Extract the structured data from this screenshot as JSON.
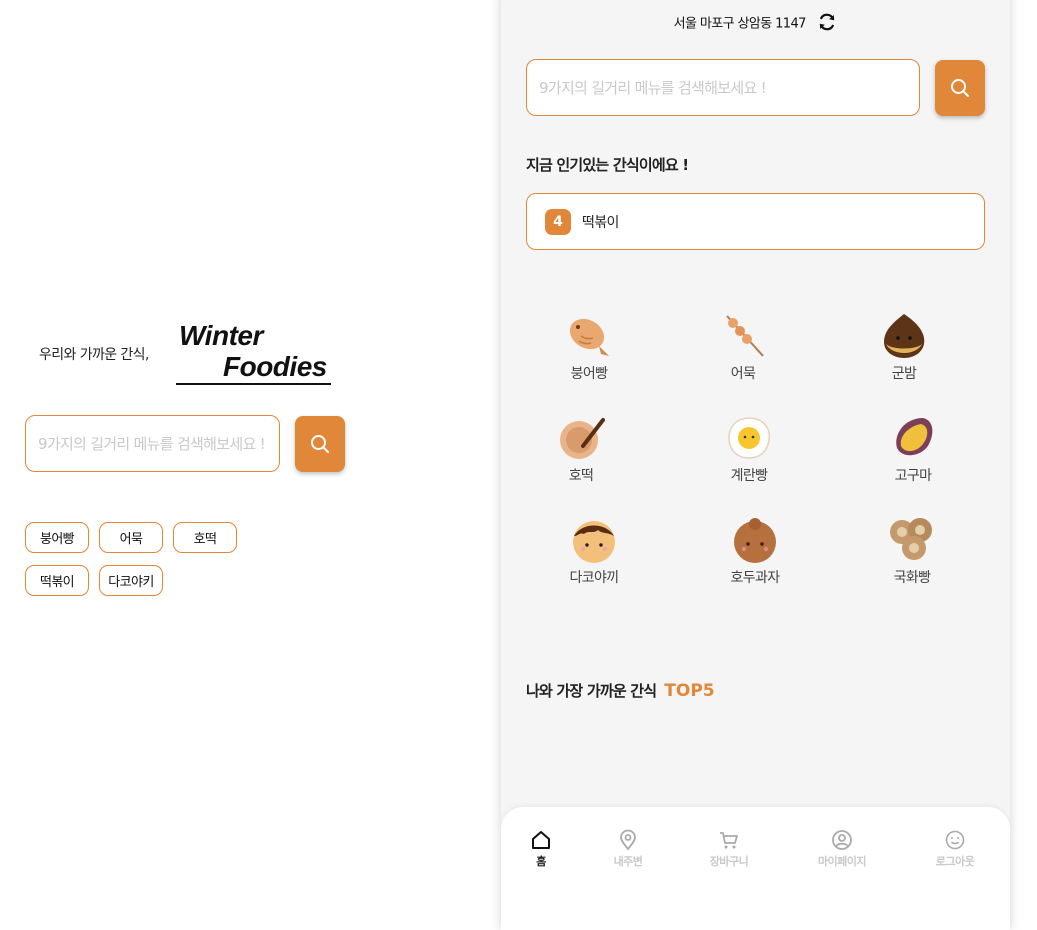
{
  "landing": {
    "tagline": "우리와 가까운 간식,",
    "brand_line1": "Winter",
    "brand_line2": "Foodies",
    "search_placeholder": "9가지의 길거리 메뉴를 검색해보세요 !",
    "chips": [
      "붕어빵",
      "어묵",
      "호떡",
      "떡볶이",
      "다코야키"
    ]
  },
  "phone": {
    "location": "서울 마포구 상암동 1147",
    "search_placeholder": "9가지의 길거리 메뉴를 검색해보세요 !",
    "popular_title": "지금 인기있는 간식이에요 !",
    "popular_rank": "4",
    "popular_name": "떡볶이",
    "menu": [
      {
        "label": "붕어빵",
        "icon": "fish-bread-icon"
      },
      {
        "label": "어묵",
        "icon": "fish-cake-skewer-icon"
      },
      {
        "label": "군밤",
        "icon": "roasted-chestnut-icon"
      },
      {
        "label": "호떡",
        "icon": "hotteok-icon"
      },
      {
        "label": "계란빵",
        "icon": "egg-bread-icon"
      },
      {
        "label": "고구마",
        "icon": "sweet-potato-icon"
      },
      {
        "label": "다코야끼",
        "icon": "takoyaki-icon"
      },
      {
        "label": "호두과자",
        "icon": "walnut-cake-icon"
      },
      {
        "label": "국화빵",
        "icon": "chrysanthemum-bread-icon"
      }
    ],
    "top5_title": "나와 가장 가까운 간식",
    "top5_accent": "TOP5",
    "nav": [
      {
        "label": "홈",
        "icon": "home-icon"
      },
      {
        "label": "내주변",
        "icon": "location-pin-icon"
      },
      {
        "label": "장바구니",
        "icon": "cart-icon"
      },
      {
        "label": "마이페이지",
        "icon": "user-circle-icon"
      },
      {
        "label": "로그아웃",
        "icon": "smile-icon"
      }
    ]
  },
  "colors": {
    "accent": "#e0873a",
    "phone_bg": "#f5f5f5",
    "placeholder": "#c9c9c9"
  }
}
